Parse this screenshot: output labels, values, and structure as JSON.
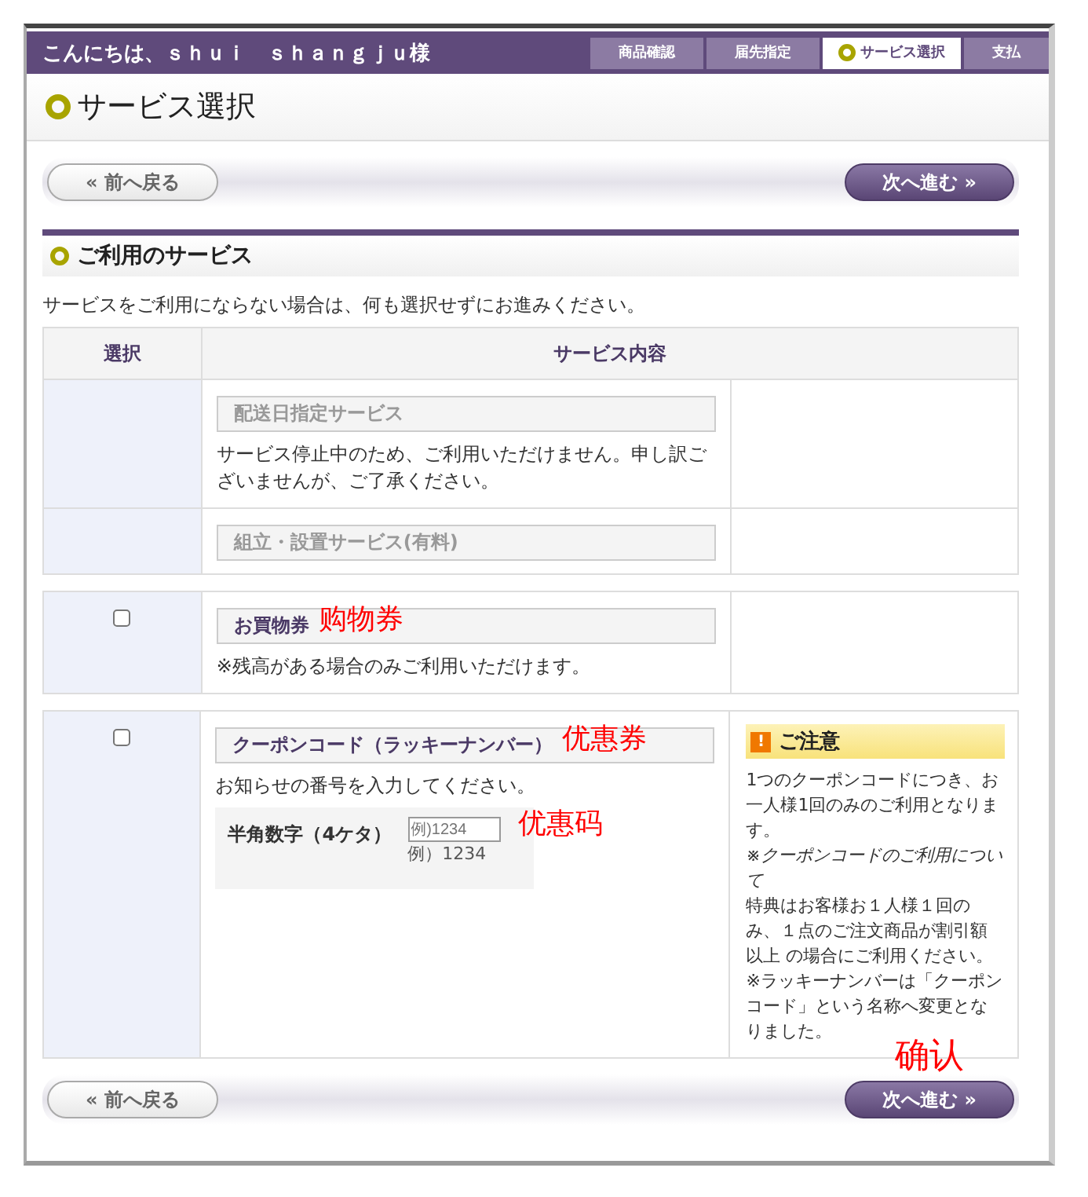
{
  "header": {
    "greeting": "こんにちは、ｓｈｕｉ　ｓｈａｎｇｊｕ様",
    "steps": [
      {
        "label": "商品確認",
        "selected": false
      },
      {
        "label": "届先指定",
        "selected": false
      },
      {
        "label": "サービス選択",
        "selected": true
      },
      {
        "label": "支払",
        "selected": false
      }
    ]
  },
  "page_title": "サービス選択",
  "top_nav": {
    "back": "«  前へ戻る",
    "next": "次へ進む  »"
  },
  "section_title": "ご利用のサービス",
  "intro": "サービスをご利用にならない場合は、何も選択せずにお進みください。",
  "table": {
    "columns": [
      "選択",
      "サービス内容"
    ],
    "groups": [
      {
        "rows": [
          {
            "kind": "unavailable",
            "title": "配送日指定サービス",
            "description": "サービス停止中のため、ご利用いただけません。申し訳ございませんが、ご了承ください。"
          },
          {
            "kind": "unavailable",
            "title": "組立・設置サービス(有料)"
          }
        ]
      },
      {
        "rows": [
          {
            "kind": "selectable",
            "checked": false,
            "title": "お買物券",
            "annotation": "购物券",
            "description": "※残高がある場合のみご利用いただけます。"
          }
        ]
      },
      {
        "rows": [
          {
            "kind": "selectable",
            "checked": false,
            "title": "クーポンコード（ラッキーナンバー）",
            "annotation": "优惠券",
            "description": "お知らせの番号を入力してください。",
            "input": {
              "label": "半角数字（4ケタ）",
              "placeholder": "例)1234",
              "hint": "例）1234",
              "annotation": "优惠码"
            },
            "notice": {
              "title": "ご注意",
              "icon": "!",
              "paragraphs": [
                {
                  "kind": "plain",
                  "text": "1つのクーポンコードにつき、お一人様1回のみのご利用となります。"
                },
                {
                  "kind": "italic",
                  "text": "※クーポンコードのご利用について"
                },
                {
                  "kind": "plain",
                  "text": "特典はお客様お１人様１回のみ、１点のご注文商品が割引額以上 の場合にご利用ください。"
                },
                {
                  "kind": "plain",
                  "text": "※ラッキーナンバーは「クーポンコード」という名称へ変更となりました。"
                }
              ]
            }
          }
        ]
      }
    ]
  },
  "bottom_nav": {
    "back": "«  前へ戻る",
    "next": "次へ進む  »",
    "annotation": "确认"
  }
}
